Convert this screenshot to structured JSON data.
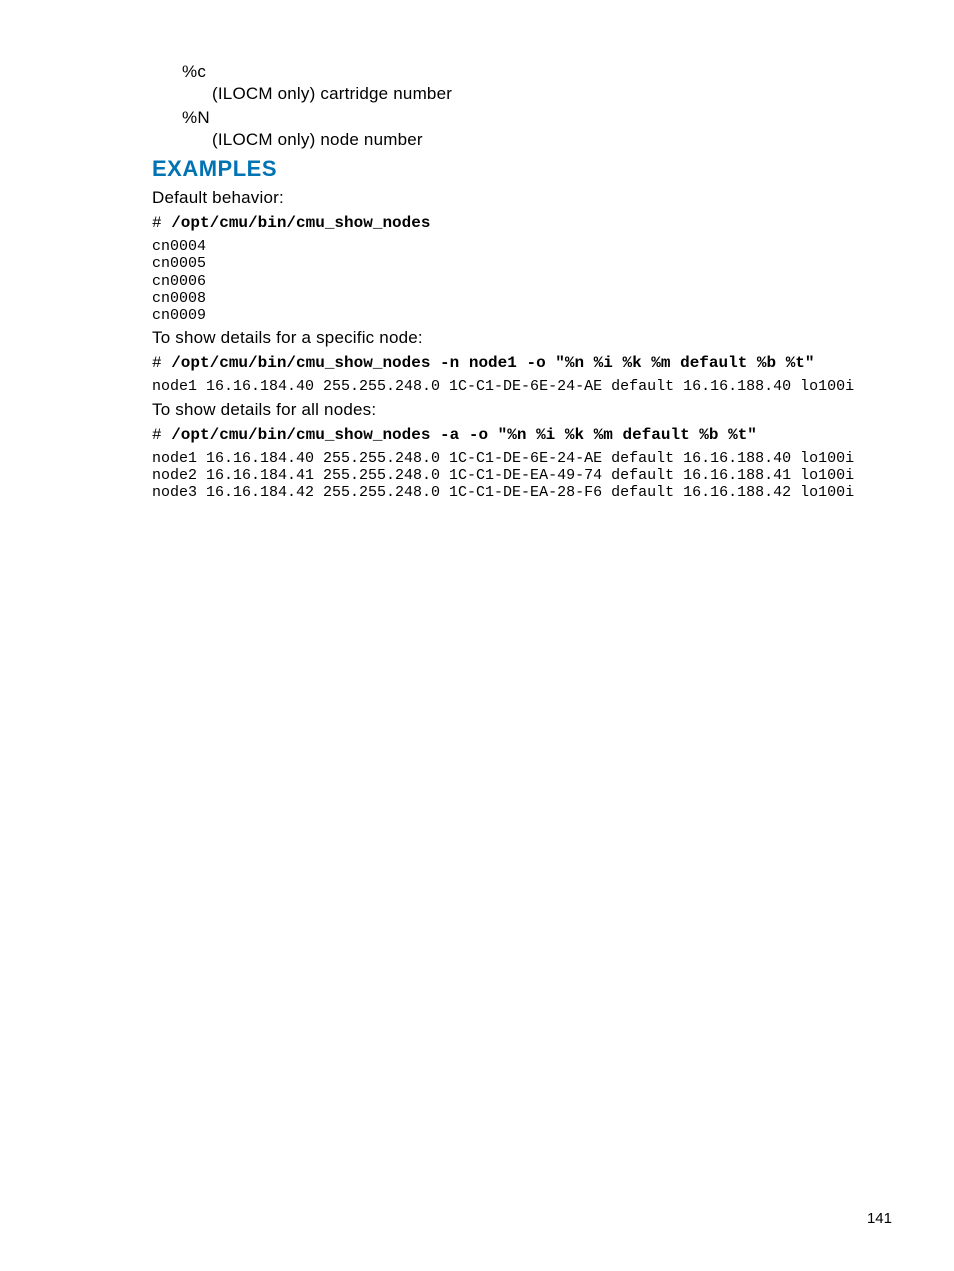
{
  "definitions": [
    {
      "term": "%c",
      "desc": "(ILOCM only) cartridge number"
    },
    {
      "term": "%N",
      "desc": "(ILOCM only) node number"
    }
  ],
  "section_heading": "EXAMPLES",
  "examples": {
    "ex1": {
      "intro": "Default behavior:",
      "prompt": "# ",
      "cmd": "/opt/cmu/bin/cmu_show_nodes",
      "output": "cn0004\ncn0005\ncn0006\ncn0008\ncn0009"
    },
    "ex2": {
      "intro": "To show details for a specific node:",
      "prompt": "# ",
      "cmd": "/opt/cmu/bin/cmu_show_nodes -n node1 -o \"%n %i %k %m default %b %t\"",
      "output": "node1 16.16.184.40 255.255.248.0 1C-C1-DE-6E-24-AE default 16.16.188.40 lo100i"
    },
    "ex3": {
      "intro": "To show details for all nodes:",
      "prompt": "# ",
      "cmd": "/opt/cmu/bin/cmu_show_nodes -a -o \"%n %i %k %m default %b %t\"",
      "output": "node1 16.16.184.40 255.255.248.0 1C-C1-DE-6E-24-AE default 16.16.188.40 lo100i\nnode2 16.16.184.41 255.255.248.0 1C-C1-DE-EA-49-74 default 16.16.188.41 lo100i\nnode3 16.16.184.42 255.255.248.0 1C-C1-DE-EA-28-F6 default 16.16.188.42 lo100i"
    }
  },
  "page_number": "141"
}
